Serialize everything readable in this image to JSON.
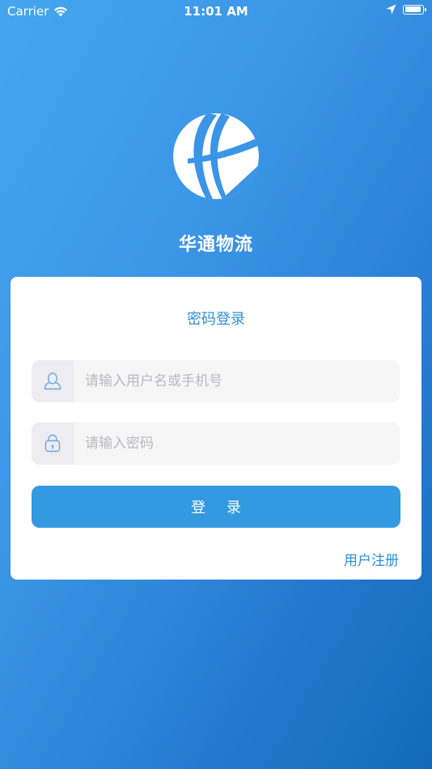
{
  "status_bar": {
    "carrier": "Carrier",
    "time": "11:01 AM",
    "battery_level": 0.95
  },
  "app": {
    "name": "华通物流"
  },
  "login_card": {
    "title": "密码登录",
    "username_placeholder": "请输入用户名或手机号",
    "username_value": "",
    "password_placeholder": "请输入密码",
    "password_value": "",
    "login_button_label": "登 录",
    "register_link_label": "用户注册"
  },
  "icons": {
    "username": "user-icon",
    "password": "lock-icon",
    "wifi": "wifi-icon",
    "location": "location-arrow-icon",
    "battery": "battery-icon"
  },
  "colors": {
    "accent": "#3399e0",
    "link": "#2f8fd8",
    "background_start": "#45a6ee",
    "background_end": "#136ab8"
  }
}
